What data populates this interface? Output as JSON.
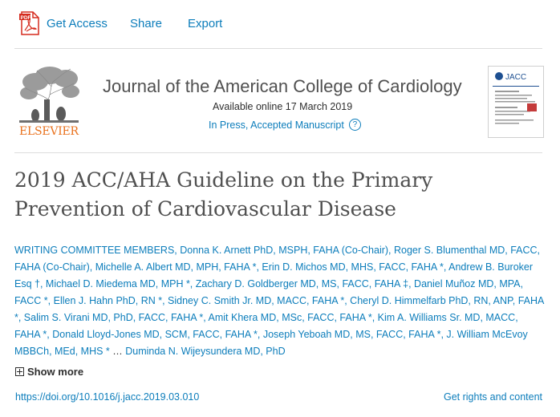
{
  "toolbar": {
    "pdf_icon_text": "PDF",
    "get_access": "Get Access",
    "share": "Share",
    "export": "Export"
  },
  "journal": {
    "publisher_logo_text": "ELSEVIER",
    "title": "Journal of the American College of Cardiology",
    "available": "Available online 17 March 2019",
    "status": "In Press, Accepted Manuscript",
    "help_icon": "?",
    "cover_label": "JACC"
  },
  "article": {
    "title_line1": "2019 ACC/AHA Guideline on the Primary",
    "title_line2": "Prevention of Cardiovascular Disease",
    "authors_text": "WRITING COMMITTEE MEMBERS, Donna K. Arnett PhD, MSPH, FAHA (Co-Chair), Roger S. Blumenthal MD, FACC, FAHA (Co-Chair), Michelle A. Albert MD, MPH, FAHA *, Erin D. Michos MD, MHS, FACC, FAHA *, Andrew B. Buroker Esq †, Michael D. Miedema MD, MPH *, Zachary D. Goldberger MD, MS, FACC, FAHA ‡, Daniel Muñoz MD, MPA, FACC *, Ellen J. Hahn PhD, RN *, Sidney C. Smith Jr. MD, MACC, FAHA *, Cheryl D. Himmelfarb PhD, RN, ANP, FAHA *, Salim S. Virani MD, PhD, FACC, FAHA *, Amit Khera MD, MSc, FACC, FAHA *, Kim A. Williams Sr. MD, MACC, FAHA *, Donald Lloyd-Jones MD, SCM, FACC, FAHA *, Joseph Yeboah MD, MS, FACC, FAHA *, J. William McEvoy MBBCh, MEd, MHS *",
    "ellipsis": " … ",
    "last_author": "Duminda N. Wijeysundera MD, PhD",
    "show_more": "Show more",
    "doi": "https://doi.org/10.1016/j.jacc.2019.03.010",
    "rights": "Get rights and content"
  },
  "colors": {
    "link": "#0c7dbb",
    "text": "#2e2e2e",
    "title": "#505050",
    "elsevier_orange": "#e9711c",
    "pdf_red": "#d52b1e"
  }
}
